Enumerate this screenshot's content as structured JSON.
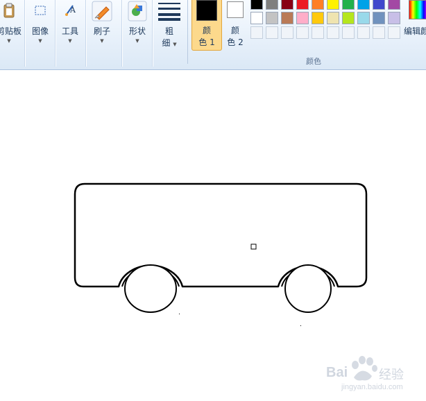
{
  "ribbon": {
    "clipboard_label": "剪贴板",
    "image_label": "图像",
    "tools_label": "工具",
    "brushes_label": "刷子",
    "shapes_label": "形状",
    "size_label_1": "粗",
    "size_label_2": "细",
    "color1_label_1": "颜",
    "color1_label_2": "色 1",
    "color2_label_1": "颜",
    "color2_label_2": "色 2",
    "colors_group_label": "颜色",
    "edit_colors_label": "编辑颜"
  },
  "palette": {
    "row1": [
      "#000000",
      "#7f7f7f",
      "#880015",
      "#ed1c24",
      "#ff7f27",
      "#fff200",
      "#22b14c",
      "#00a2e8",
      "#3f48cc",
      "#a349a4"
    ],
    "row2": [
      "#ffffff",
      "#c3c3c3",
      "#b97a57",
      "#ffaec9",
      "#ffc90e",
      "#efe4b0",
      "#b5e61d",
      "#99d9ea",
      "#7092be",
      "#c8bfe7"
    ],
    "row3": [
      "#f0f4f9",
      "#f0f4f9",
      "#f0f4f9",
      "#f0f4f9",
      "#f0f4f9",
      "#f0f4f9",
      "#f0f4f9",
      "#f0f4f9",
      "#f0f4f9",
      "#f0f4f9"
    ]
  },
  "colors": {
    "color1": "#000000",
    "color2": "#ffffff",
    "selected_button_bg": "#fcd98c",
    "ink": "#000000"
  },
  "watermark": {
    "brand": "Bai",
    "brand2": "经验",
    "url": "jingyan.baidu.com"
  }
}
